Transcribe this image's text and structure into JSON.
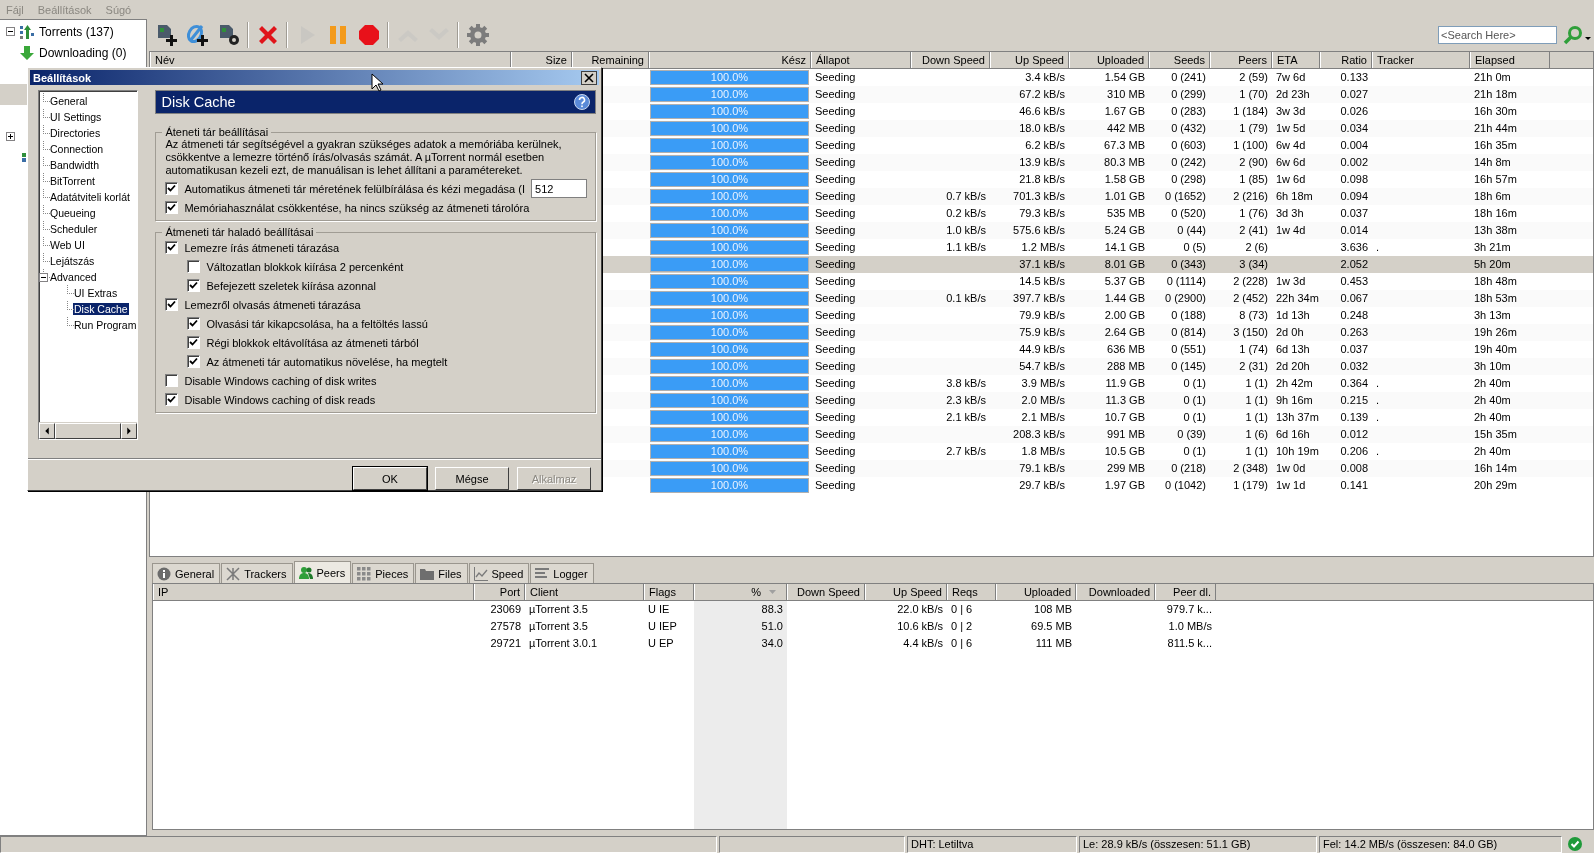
{
  "menu": [
    "Fájl",
    "Beállítások",
    "Súgó"
  ],
  "sidebar": {
    "items": [
      {
        "kind": "root",
        "label": "Torrents (137)",
        "expanded": true,
        "selected": false
      },
      {
        "kind": "downloading",
        "label": "Downloading (0)",
        "selected": false
      },
      {
        "kind": "blank",
        "selected": false
      },
      {
        "kind": "blank",
        "selected": true
      },
      {
        "kind": "blank",
        "selected": false
      },
      {
        "kind": "group",
        "expanded": false,
        "selected": false
      },
      {
        "kind": "feed",
        "selected": false
      }
    ]
  },
  "toolbar": [
    {
      "kind": "add-file",
      "disabled": false
    },
    {
      "kind": "add-link",
      "disabled": false
    },
    {
      "kind": "create",
      "disabled": false
    },
    {
      "kind": "remove",
      "disabled": false
    },
    {
      "kind": "start",
      "disabled": true
    },
    {
      "kind": "pause",
      "disabled": false
    },
    {
      "kind": "stop",
      "disabled": false
    },
    {
      "kind": "move-up",
      "disabled": true
    },
    {
      "kind": "move-down",
      "disabled": true
    },
    {
      "kind": "settings",
      "disabled": false
    }
  ],
  "search": {
    "placeholder": "<Search Here>"
  },
  "torrents": {
    "columns": [
      "Név",
      "Size",
      "Remaining",
      "Kész",
      "Állapot",
      "Down Speed",
      "Up Speed",
      "Uploaded",
      "Seeds",
      "Peers",
      "ETA",
      "Ratio",
      "Tracker",
      "Elapsed"
    ],
    "rows": [
      {
        "done": "100.0%",
        "level": 1,
        "status": "Seeding",
        "up": "3.4 kB/s",
        "uploaded": "1.54 GB",
        "seeds": "0 (241)",
        "peers": "2 (59)",
        "eta": "7w 6d",
        "ratio": "0.133",
        "elapsed": "21h 0m",
        "selected": false
      },
      {
        "done": "100.0%",
        "level": 1,
        "status": "Seeding",
        "up": "67.2 kB/s",
        "uploaded": "310 MB",
        "seeds": "0 (299)",
        "peers": "1 (70)",
        "eta": "2d 23h",
        "ratio": "0.027",
        "elapsed": "21h 18m",
        "selected": false
      },
      {
        "done": "100.0%",
        "level": 1,
        "status": "Seeding",
        "up": "46.6 kB/s",
        "uploaded": "1.67 GB",
        "seeds": "0 (283)",
        "peers": "1 (184)",
        "eta": "3w 3d",
        "ratio": "0.026",
        "elapsed": "16h 30m",
        "selected": false
      },
      {
        "done": "100.0%",
        "level": 1,
        "status": "Seeding",
        "up": "18.0 kB/s",
        "uploaded": "442 MB",
        "seeds": "0 (432)",
        "peers": "1 (79)",
        "eta": "1w 5d",
        "ratio": "0.034",
        "elapsed": "21h 44m",
        "selected": false
      },
      {
        "done": "100.0%",
        "level": 1,
        "status": "Seeding",
        "up": "6.2 kB/s",
        "uploaded": "67.3 MB",
        "seeds": "0 (603)",
        "peers": "1 (100)",
        "eta": "6w 4d",
        "ratio": "0.004",
        "elapsed": "16h 35m",
        "selected": false
      },
      {
        "done": "100.0%",
        "level": 1,
        "status": "Seeding",
        "up": "13.9 kB/s",
        "uploaded": "80.3 MB",
        "seeds": "0 (242)",
        "peers": "2 (90)",
        "eta": "6w 6d",
        "ratio": "0.002",
        "elapsed": "14h 8m",
        "selected": false
      },
      {
        "done": "100.0%",
        "level": 1,
        "status": "Seeding",
        "up": "21.8 kB/s",
        "uploaded": "1.58 GB",
        "seeds": "0 (298)",
        "peers": "1 (85)",
        "eta": "1w 6d",
        "ratio": "0.098",
        "elapsed": "16h 57m",
        "selected": false
      },
      {
        "done": "100.0%",
        "level": 1,
        "status": "Seeding",
        "down": "0.7 kB/s",
        "up": "701.3 kB/s",
        "uploaded": "1.01 GB",
        "seeds": "0 (1652)",
        "peers": "2 (216)",
        "eta": "6h 18m",
        "ratio": "0.094",
        "elapsed": "18h 6m",
        "selected": false
      },
      {
        "done": "100.0%",
        "level": 1,
        "status": "Seeding",
        "down": "0.2 kB/s",
        "up": "79.3 kB/s",
        "uploaded": "535 MB",
        "seeds": "0 (520)",
        "peers": "1 (76)",
        "eta": "3d 3h",
        "ratio": "0.037",
        "elapsed": "18h 16m",
        "selected": false
      },
      {
        "done": "100.0%",
        "level": 1,
        "status": "Seeding",
        "down": "1.0 kB/s",
        "up": "575.6 kB/s",
        "uploaded": "5.24 GB",
        "seeds": "0 (44)",
        "peers": "2 (41)",
        "eta": "1w 4d",
        "ratio": "0.014",
        "elapsed": "13h 38m",
        "selected": false
      },
      {
        "done": "100.0%",
        "level": 1,
        "status": "Seeding",
        "down": "1.1 kB/s",
        "up": "1.2 MB/s",
        "uploaded": "14.1 GB",
        "seeds": "0 (5)",
        "peers": "2 (6)",
        "ratio": "3.636",
        "tracker": ".",
        "elapsed": "3h 21m",
        "selected": false
      },
      {
        "done": "100.0%",
        "level": 1,
        "status": "Seeding",
        "up": "37.1 kB/s",
        "uploaded": "8.01 GB",
        "seeds": "0 (343)",
        "peers": "3 (34)",
        "ratio": "2.052",
        "elapsed": "5h 20m",
        "selected": true
      },
      {
        "done": "100.0%",
        "level": 1,
        "status": "Seeding",
        "up": "14.5 kB/s",
        "uploaded": "5.37 GB",
        "seeds": "0 (1114)",
        "peers": "2 (228)",
        "eta": "1w 3d",
        "ratio": "0.453",
        "elapsed": "18h 48m",
        "selected": false
      },
      {
        "done": "100.0%",
        "level": 1,
        "status": "Seeding",
        "down": "0.1 kB/s",
        "up": "397.7 kB/s",
        "uploaded": "1.44 GB",
        "seeds": "0 (2900)",
        "peers": "2 (452)",
        "eta": "22h 34m",
        "ratio": "0.067",
        "elapsed": "18h 53m",
        "selected": false
      },
      {
        "done": "100.0%",
        "level": 1,
        "status": "Seeding",
        "up": "79.9 kB/s",
        "uploaded": "2.00 GB",
        "seeds": "0 (188)",
        "peers": "8 (73)",
        "eta": "1d 13h",
        "ratio": "0.248",
        "elapsed": "3h 13m",
        "selected": false
      },
      {
        "done": "100.0%",
        "level": 1,
        "status": "Seeding",
        "up": "75.9 kB/s",
        "uploaded": "2.64 GB",
        "seeds": "0 (814)",
        "peers": "3 (150)",
        "eta": "2d 0h",
        "ratio": "0.263",
        "elapsed": "19h 26m",
        "selected": false
      },
      {
        "done": "100.0%",
        "level": 1,
        "status": "Seeding",
        "up": "44.9 kB/s",
        "uploaded": "636 MB",
        "seeds": "0 (551)",
        "peers": "1 (74)",
        "eta": "6d 13h",
        "ratio": "0.037",
        "elapsed": "19h 40m",
        "selected": false
      },
      {
        "done": "100.0%",
        "level": 1,
        "status": "Seeding",
        "up": "54.7 kB/s",
        "uploaded": "288 MB",
        "seeds": "0 (145)",
        "peers": "2 (31)",
        "eta": "2d 20h",
        "ratio": "0.032",
        "elapsed": "3h 10m",
        "selected": false
      },
      {
        "done": "100.0%",
        "level": 1,
        "status": "Seeding",
        "down": "3.8 kB/s",
        "up": "3.9 MB/s",
        "uploaded": "11.9 GB",
        "seeds": "0 (1)",
        "peers": "1 (1)",
        "eta": "2h 42m",
        "ratio": "0.364",
        "tracker": ".",
        "elapsed": "2h 40m",
        "selected": false
      },
      {
        "done": "100.0%",
        "level": 1,
        "status": "Seeding",
        "down": "2.3 kB/s",
        "up": "2.0 MB/s",
        "uploaded": "11.3 GB",
        "seeds": "0 (1)",
        "peers": "1 (1)",
        "eta": "9h 16m",
        "ratio": "0.215",
        "tracker": ".",
        "elapsed": "2h 40m",
        "selected": false
      },
      {
        "done": "100.0%",
        "level": 1,
        "status": "Seeding",
        "down": "2.1 kB/s",
        "up": "2.1 MB/s",
        "uploaded": "10.7 GB",
        "seeds": "0 (1)",
        "peers": "1 (1)",
        "eta": "13h 37m",
        "ratio": "0.139",
        "tracker": ".",
        "elapsed": "2h 40m",
        "selected": false
      },
      {
        "done": "100.0%",
        "level": 1,
        "status": "Seeding",
        "up": "208.3 kB/s",
        "uploaded": "991 MB",
        "seeds": "0 (39)",
        "peers": "1 (6)",
        "eta": "6d 16h",
        "ratio": "0.012",
        "elapsed": "15h 35m",
        "selected": false
      },
      {
        "done": "100.0%",
        "level": 1,
        "status": "Seeding",
        "down": "2.7 kB/s",
        "up": "1.8 MB/s",
        "uploaded": "10.5 GB",
        "seeds": "0 (1)",
        "peers": "1 (1)",
        "eta": "10h 19m",
        "ratio": "0.206",
        "tracker": ".",
        "elapsed": "2h 40m",
        "selected": false
      },
      {
        "done": "100.0%",
        "level": 1,
        "status": "Seeding",
        "up": "79.1 kB/s",
        "uploaded": "299 MB",
        "seeds": "0 (218)",
        "peers": "2 (348)",
        "eta": "1w 0d",
        "ratio": "0.008",
        "elapsed": "16h 14m",
        "selected": false
      },
      {
        "done": "100.0%",
        "level": 1,
        "status": "Seeding",
        "up": "29.7 kB/s",
        "uploaded": "1.97 GB",
        "seeds": "0 (1042)",
        "peers": "1 (179)",
        "eta": "1w 1d",
        "ratio": "0.141",
        "elapsed": "20h 29m",
        "selected": false
      }
    ]
  },
  "details": {
    "tabs": [
      {
        "kind": "info",
        "label": "General",
        "selected": false
      },
      {
        "kind": "trackers",
        "label": "Trackers",
        "selected": false
      },
      {
        "kind": "peers",
        "label": "Peers",
        "selected": true
      },
      {
        "kind": "pieces",
        "label": "Pieces",
        "selected": false
      },
      {
        "kind": "files",
        "label": "Files",
        "selected": false
      },
      {
        "kind": "speed",
        "label": "Speed",
        "selected": false
      },
      {
        "kind": "logger",
        "label": "Logger",
        "selected": false
      }
    ],
    "columns": [
      {
        "label": "IP",
        "sorted": false
      },
      {
        "label": "Port",
        "sorted": false
      },
      {
        "label": "Client",
        "sorted": false
      },
      {
        "label": "Flags",
        "sorted": false
      },
      {
        "label": "%",
        "sorted": true
      },
      {
        "label": "Down Speed",
        "sorted": false
      },
      {
        "label": "Up Speed",
        "sorted": false
      },
      {
        "label": "Reqs",
        "sorted": false
      },
      {
        "label": "Uploaded",
        "sorted": false
      },
      {
        "label": "Downloaded",
        "sorted": false
      },
      {
        "label": "Peer dl.",
        "sorted": false
      }
    ],
    "rows": [
      {
        "port": "23069",
        "client": "µTorrent 3.5",
        "flags": "U IE",
        "pct": "88.3",
        "up": "22.0 kB/s",
        "reqs": "0 | 6",
        "uploaded": "108 MB",
        "peer_dl": "979.7 k..."
      },
      {
        "port": "27578",
        "client": "µTorrent 3.5",
        "flags": "U IEP",
        "pct": "51.0",
        "up": "10.6 kB/s",
        "reqs": "0 | 2",
        "uploaded": "69.5 MB",
        "peer_dl": "1.0 MB/s"
      },
      {
        "port": "29721",
        "client": "µTorrent 3.0.1",
        "flags": "U EP",
        "pct": "34.0",
        "up": "4.4 kB/s",
        "reqs": "0 | 6",
        "uploaded": "111 MB",
        "peer_dl": "811.5 k..."
      }
    ]
  },
  "settings_dialog": {
    "title": "Beállítások",
    "tree": [
      {
        "label": "General",
        "selected": false
      },
      {
        "label": "UI Settings",
        "selected": false
      },
      {
        "label": "Directories",
        "selected": false
      },
      {
        "label": "Connection",
        "selected": false
      },
      {
        "label": "Bandwidth",
        "selected": false
      },
      {
        "label": "BitTorrent",
        "selected": false
      },
      {
        "label": "Adatátviteli korlát",
        "selected": false
      },
      {
        "label": "Queueing",
        "selected": false
      },
      {
        "label": "Scheduler",
        "selected": false
      },
      {
        "label": "Web UI",
        "selected": false
      },
      {
        "label": "Lejátszás",
        "selected": false
      },
      {
        "label": "Advanced",
        "selected": false,
        "expanded": true,
        "children": [
          {
            "label": "UI Extras",
            "selected": false
          },
          {
            "label": "Disk Cache",
            "selected": true
          },
          {
            "label": "Run Program",
            "selected": false
          }
        ]
      }
    ],
    "page_title": "Disk Cache",
    "groups": [
      {
        "title": "Áteneti tár beállításai",
        "description": "Az átmeneti tár segítségével a gyakran szükséges adatok a memóriába kerülnek, csökkentve a lemezre történő írás/olvasás számát. A µTorrent normál esetben automatikusan kezeli ezt, de manuálisan is lehet állítani a paramétereket.",
        "options": [
          {
            "label": "Automatikus átmeneti tár méretének felülbírálása és kézi megadása (I",
            "checked": true,
            "value": "512"
          },
          {
            "label": "Memóriahasználat csökkentése, ha nincs szükség az átmeneti tárolóra",
            "checked": true
          }
        ]
      },
      {
        "title": "Átmeneti tár haladó beállításai",
        "options": [
          {
            "label": "Lemezre írás átmeneti tárazása",
            "checked": true,
            "children": [
              {
                "label": "Változatlan blokkok kiírása 2 percenként",
                "checked": false
              },
              {
                "label": "Befejezett szeletek kiírása azonnal",
                "checked": true
              }
            ]
          },
          {
            "label": "Lemezről olvasás átmeneti tárazása",
            "checked": true,
            "children": [
              {
                "label": "Olvasási tár kikapcsolása, ha a feltöltés lassú",
                "checked": true
              },
              {
                "label": "Régi blokkok eltávolítása az átmeneti tárból",
                "checked": true
              },
              {
                "label": "Az átmeneti tár automatikus növelése, ha megtelt",
                "checked": true
              }
            ]
          },
          {
            "label": "Disable Windows caching of disk writes",
            "checked": false
          },
          {
            "label": "Disable Windows caching of disk reads",
            "checked": true
          }
        ]
      }
    ],
    "buttons": [
      {
        "label": "OK",
        "default": true,
        "disabled": false
      },
      {
        "label": "Mégse",
        "default": false,
        "disabled": false
      },
      {
        "label": "Alkalmaz",
        "default": false,
        "disabled": true
      }
    ]
  },
  "status_bar": {
    "fields": [
      "DHT: Letiltva",
      "Le: 28.9 kB/s (összesen: 51.1 GB)",
      "Fel: 14.2 MB/s (összesen: 84.0 GB)"
    ]
  }
}
